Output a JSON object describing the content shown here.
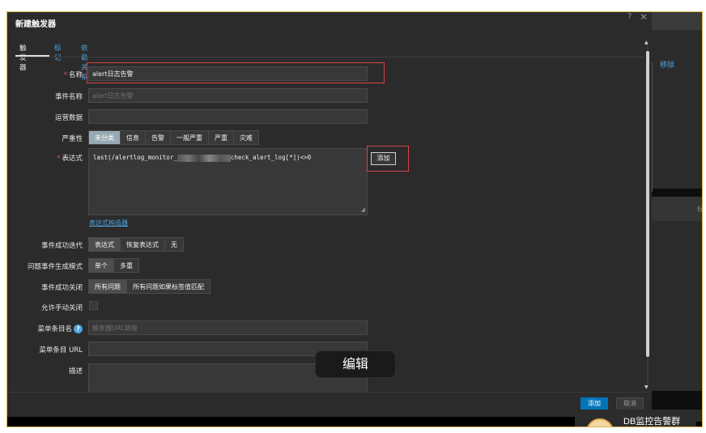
{
  "dialog": {
    "title": "新建触发器",
    "help": "?",
    "close": "✕"
  },
  "tabs": [
    "触发器",
    "标记",
    "依赖关系"
  ],
  "form": {
    "name_label": "名称",
    "name_value": "alert日志告警",
    "event_name_label": "事件名称",
    "event_name_placeholder": "alert日志告警",
    "opdata_label": "运营数据",
    "severity_label": "严重性",
    "severity_options": [
      "未分类",
      "信息",
      "告警",
      "一般严重",
      "严重",
      "灾难"
    ],
    "severity_selected": "未分类",
    "expression_label": "表达式",
    "expression_prefix": "last(/alertlog_monitor_",
    "expression_suffix": "check_alert_log[*])<>0",
    "add_label": "添加",
    "expr_builder_link": "表达式构造器",
    "ok_event_label": "事件成功迭代",
    "ok_event_options": [
      "表达式",
      "恢复表达式",
      "无"
    ],
    "problem_mode_label": "问题事件生成模式",
    "problem_mode_options": [
      "单个",
      "多重"
    ],
    "ok_close_label": "事件成功关闭",
    "ok_close_options": [
      "所有问题",
      "所有问题如果标签值匹配"
    ],
    "manual_close_label": "允许手动关闭",
    "url_name_label": "菜单条目名",
    "url_name_placeholder": "触发器URL链接",
    "url_label": "菜单条目 URL",
    "desc_label": "描述"
  },
  "footer": {
    "add": "添加",
    "cancel": "取消"
  },
  "tooltip": "编辑",
  "background": {
    "remove_link": "移除",
    "chat_text": "DB监控告警群",
    "side_label": "标"
  },
  "colors": {
    "accent": "#0275b8",
    "link": "#4fa3e0",
    "required": "#e45959",
    "highlight_box": "#d64545",
    "frame": "#d9b652"
  }
}
